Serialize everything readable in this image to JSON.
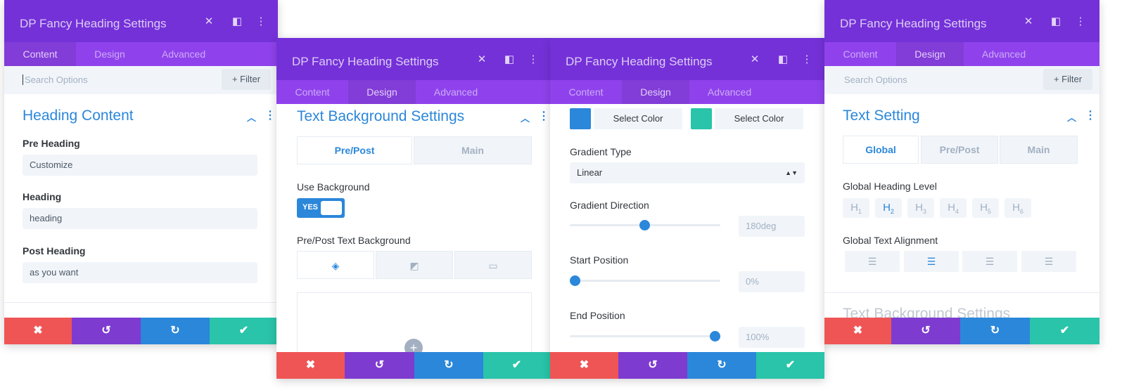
{
  "panel_title": "DP Fancy Heading Settings",
  "tabs": [
    "Content",
    "Design",
    "Advanced"
  ],
  "search_placeholder": "Search Options",
  "filter_label": "+ Filter",
  "footer": {
    "cancel": "✖",
    "undo": "↺",
    "redo": "↻",
    "save": "✔"
  },
  "p1": {
    "section": "Heading Content",
    "pre_heading": {
      "label": "Pre Heading",
      "value": "Customize"
    },
    "heading": {
      "label": "Heading",
      "value": "heading"
    },
    "post_heading": {
      "label": "Post Heading",
      "value": "as you want"
    }
  },
  "p2": {
    "section": "Text Background Settings",
    "sub_tabs": [
      "Pre/Post",
      "Main"
    ],
    "use_bg_label": "Use Background",
    "toggle_text": "YES",
    "prepost_bg_label": "Pre/Post Text Background"
  },
  "p3": {
    "select_color_1": "Select Color",
    "select_color_2": "Select Color",
    "color_1": "#2b87da",
    "color_2": "#29c4a9",
    "gradient_type_label": "Gradient Type",
    "gradient_type_value": "Linear",
    "gradient_direction_label": "Gradient Direction",
    "gradient_direction_value": "180deg",
    "start_position_label": "Start Position",
    "start_position_value": "0%",
    "end_position_label": "End Position",
    "end_position_value": "100%"
  },
  "p4": {
    "section": "Text Setting",
    "sub_tabs": [
      "Global",
      "Pre/Post",
      "Main"
    ],
    "heading_level_label": "Global Heading Level",
    "levels": [
      "H",
      "H",
      "H",
      "H",
      "H",
      "H"
    ],
    "level_subs": [
      "1",
      "2",
      "3",
      "4",
      "5",
      "6"
    ],
    "alignment_label": "Global Text Alignment",
    "next_section": "Text Background Settings"
  }
}
